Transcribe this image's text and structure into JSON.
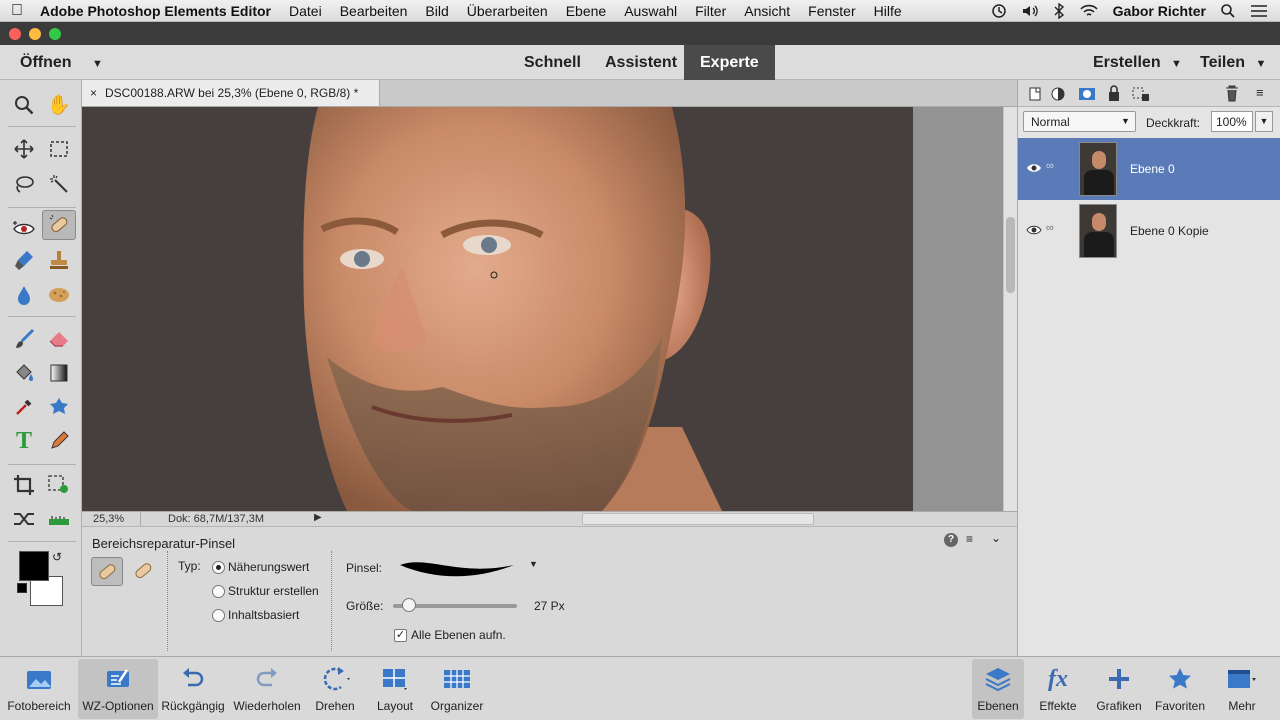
{
  "menubar": {
    "app_name": "Adobe Photoshop Elements Editor",
    "items": [
      "Datei",
      "Bearbeiten",
      "Bild",
      "Überarbeiten",
      "Ebene",
      "Auswahl",
      "Filter",
      "Ansicht",
      "Fenster",
      "Hilfe"
    ],
    "user_name": "Gabor Richter"
  },
  "modebar": {
    "open_label": "Öffnen",
    "modes": [
      "Schnell",
      "Assistent",
      "Experte"
    ],
    "active_mode": "Experte",
    "create_label": "Erstellen",
    "share_label": "Teilen"
  },
  "document": {
    "tab_title": "DSC00188.ARW bei 25,3% (Ebene 0, RGB/8) *",
    "zoom": "25,3%",
    "doc_size": "Dok: 68,7M/137,3M"
  },
  "tool_options": {
    "tool_name": "Bereichsreparatur-Pinsel",
    "type_label": "Typ:",
    "type_options": [
      "Näherungswert",
      "Struktur erstellen",
      "Inhaltsbasiert"
    ],
    "selected_type": "Näherungswert",
    "brush_label": "Pinsel:",
    "size_label": "Größe:",
    "size_value": "27 Px",
    "size_fraction": 0.13,
    "all_layers_label": "Alle Ebenen aufn.",
    "all_layers_checked": true
  },
  "layers": {
    "blend_mode": "Normal",
    "opacity_label": "Deckkraft:",
    "opacity_value": "100%",
    "items": [
      {
        "name": "Ebene 0",
        "selected": true
      },
      {
        "name": "Ebene 0 Kopie",
        "selected": false
      }
    ]
  },
  "taskbar": {
    "left": [
      "Fotobereich",
      "WZ-Optionen",
      "Rückgängig",
      "Wiederholen",
      "Drehen",
      "Layout",
      "Organizer"
    ],
    "right": [
      "Ebenen",
      "Effekte",
      "Grafiken",
      "Favoriten",
      "Mehr"
    ]
  },
  "colors": {
    "accent": "#5b7bb8",
    "active_mode_bg": "#4a4a4a",
    "foreground_color": "#000000",
    "background_color": "#ffffff"
  }
}
